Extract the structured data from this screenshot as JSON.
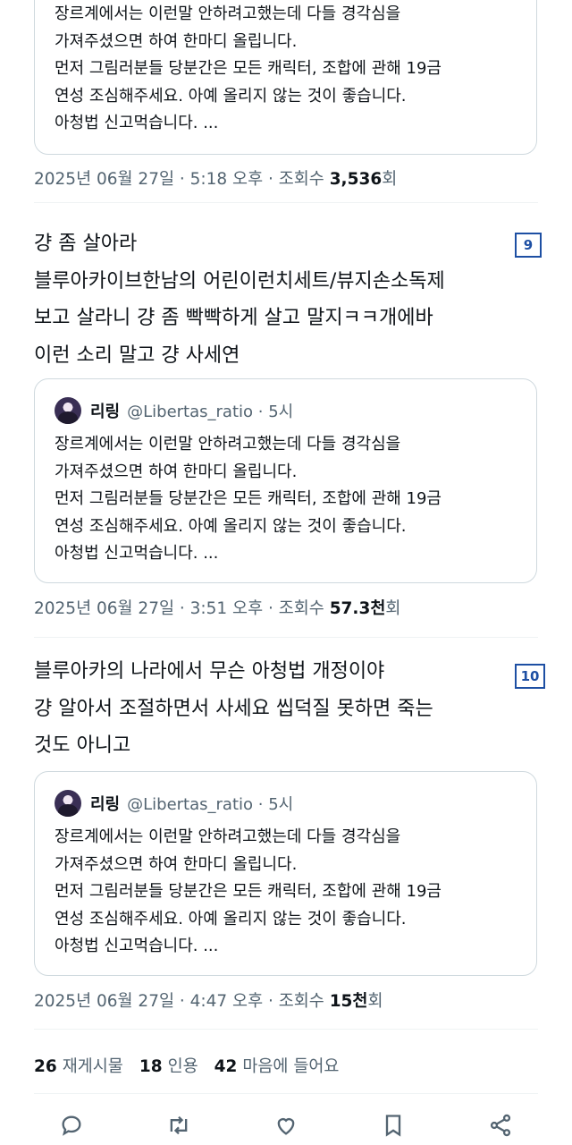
{
  "quote_text": "장르계에서는 이런말 안하려고했는데 다들 경각심을\n가져주셨으면 하여 한마디 올립니다.\n먼저 그림러분들 당분간은 모든 캐릭터, 조합에 관해 19금\n연성 조심해주세요. 아예 올리지 않는 것이 좋습니다.\n아청법 신고먹습니다. ...",
  "quote_author": {
    "name": "리링",
    "handle": "@Libertas_ratio · 5시"
  },
  "tweets": [
    {
      "meta": {
        "date": "2025년 06월 27일 · 5:18 오후 · 조회수",
        "views": "3,536",
        "unit": "회"
      }
    },
    {
      "number": "9",
      "text": "걍 좀 살아라\n블루아카이브한남의 어린이런치세트/뷰지손소독제\n보고 살라니 걍 좀 빡빡하게 살고 말지ㅋㅋ개에바\n이런 소리 말고 걍 사세연",
      "meta": {
        "date": "2025년 06월 27일 · 3:51 오후 · 조회수",
        "views": "57.3천",
        "unit": "회"
      }
    },
    {
      "number": "10",
      "text": "블루아카의 나라에서 무슨 아청법 개정이야\n걍 알아서 조절하면서 사세요 씹덕질 못하면 죽는\n것도 아니고",
      "meta": {
        "date": "2025년 06월 27일 · 4:47 오후 · 조회수",
        "views": "15천",
        "unit": "회"
      }
    }
  ],
  "stats": {
    "reposts": {
      "count": "26",
      "label": "재게시물"
    },
    "quotes": {
      "count": "18",
      "label": "인용"
    },
    "likes": {
      "count": "42",
      "label": "마음에 들어요"
    }
  },
  "icons": [
    "reply-icon",
    "repost-icon",
    "like-icon",
    "bookmark-icon",
    "share-icon"
  ],
  "colors": {
    "accent": "#1d4fa3",
    "muted": "#536471",
    "text": "#0f1419",
    "border": "#cfd9de"
  }
}
